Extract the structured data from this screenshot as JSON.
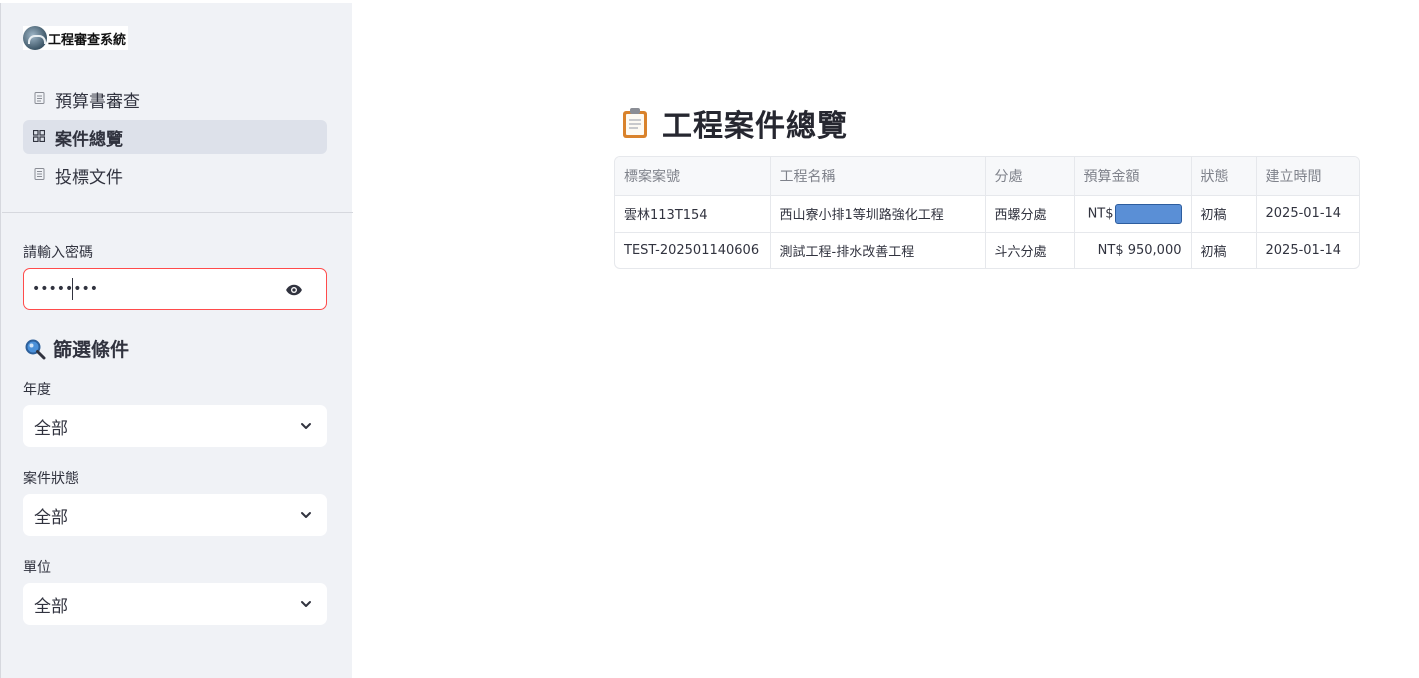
{
  "app": {
    "title": "工程審查系統"
  },
  "nav": {
    "items": [
      {
        "label": "預算書審查",
        "icon": "document-icon",
        "active": false
      },
      {
        "label": "案件總覽",
        "icon": "dashboard-icon",
        "active": true
      },
      {
        "label": "投標文件",
        "icon": "file-icon",
        "active": false
      }
    ]
  },
  "password": {
    "label": "請輸入密碼",
    "value": "••••••••"
  },
  "filters": {
    "title": "篩選條件",
    "year": {
      "label": "年度",
      "selected": "全部"
    },
    "status": {
      "label": "案件狀態",
      "selected": "全部"
    },
    "unit": {
      "label": "單位",
      "selected": "全部"
    }
  },
  "main": {
    "title": "工程案件總覽",
    "table": {
      "columns": [
        "標案案號",
        "工程名稱",
        "分處",
        "預算金額",
        "狀態",
        "建立時間"
      ],
      "rows": [
        {
          "case_no": "雲林113T154",
          "name": "西山寮小排1等圳路強化工程",
          "branch": "西螺分處",
          "budget": "NT$",
          "budget_redacted": true,
          "status": "初稿",
          "created": "2025-01-14"
        },
        {
          "case_no": "TEST-202501140606",
          "name": "測試工程-排水改善工程",
          "branch": "斗六分處",
          "budget": "NT$ 950,000",
          "budget_redacted": false,
          "status": "初稿",
          "created": "2025-01-14"
        }
      ]
    }
  },
  "colors": {
    "accent": "#ff4b4b",
    "sidebar_bg": "#f0f2f6",
    "redaction": "#5a8fd6"
  }
}
